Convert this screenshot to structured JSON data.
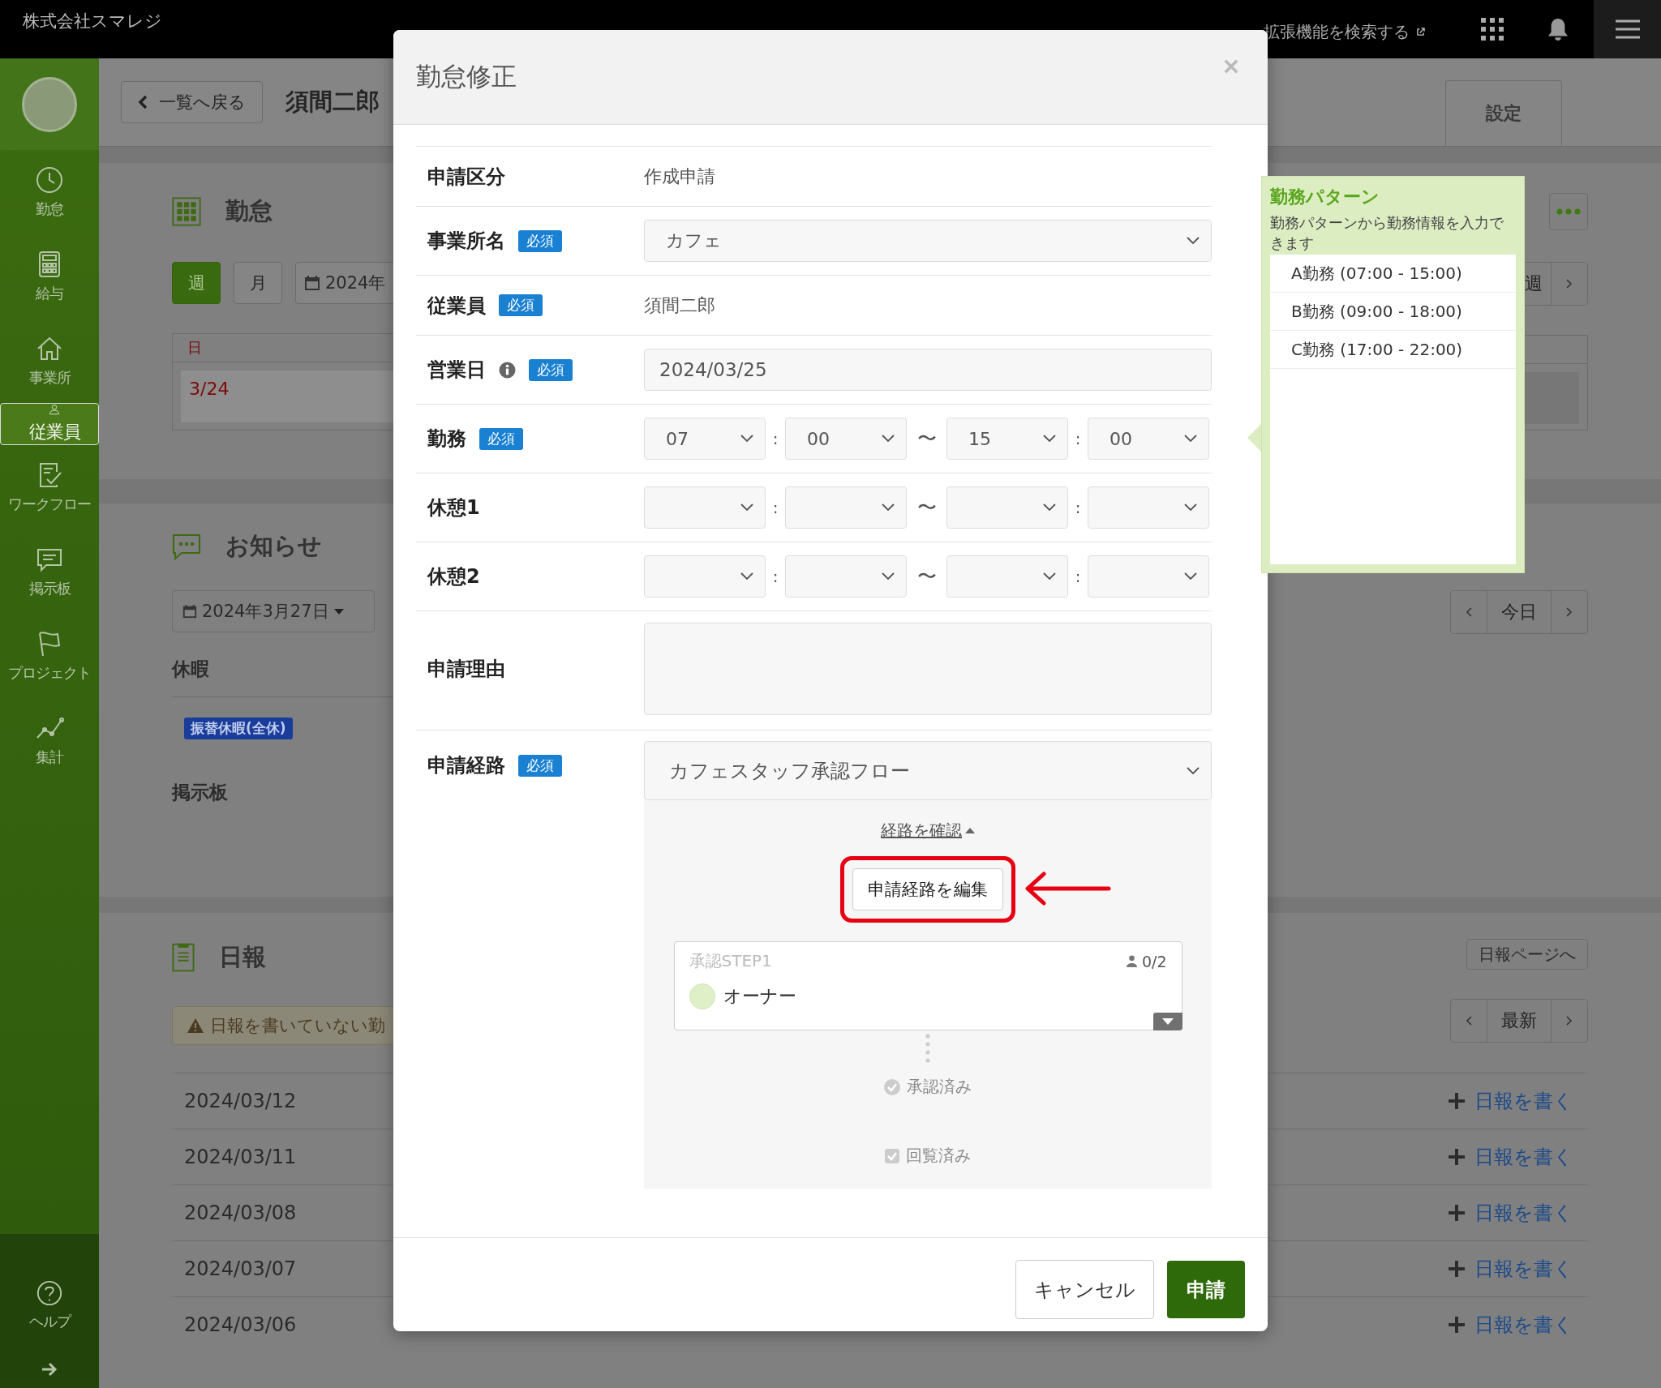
{
  "header": {
    "company": "株式会社スマレジ",
    "extension_search": "拡張機能を検索する"
  },
  "sidebar": {
    "items": [
      {
        "label": "勤怠",
        "selected": false
      },
      {
        "label": "給与",
        "selected": false
      },
      {
        "label": "事業所",
        "selected": false
      },
      {
        "label": "従業員",
        "selected": true
      },
      {
        "label": "ワークフロー",
        "selected": false
      },
      {
        "label": "掲示板",
        "selected": false
      },
      {
        "label": "プロジェクト",
        "selected": false
      },
      {
        "label": "集計",
        "selected": false
      }
    ],
    "help": "ヘルプ"
  },
  "page": {
    "back": "一覧へ戻る",
    "employee": "須間二郎",
    "settings": "設定"
  },
  "attendance": {
    "title": "勤怠",
    "views": [
      {
        "label": "週",
        "selected": true
      },
      {
        "label": "月",
        "selected": false
      }
    ],
    "date": "2024年",
    "day_header": "日",
    "day": "3/24",
    "week_label": "週"
  },
  "notices": {
    "title": "お知らせ",
    "date": "2024年3月27日",
    "vacation_heading": "休暇",
    "vacation_tag": "振替休暇(全休)",
    "board_heading": "掲示板",
    "today": "今日"
  },
  "daily_reports": {
    "title": "日報",
    "page_link": "日報ページへ",
    "warning": "日報を書いていない勤",
    "latest": "最新",
    "rows": [
      {
        "date": "2024/03/12",
        "action": "日報を書く"
      },
      {
        "date": "2024/03/11",
        "action": "日報を書く"
      },
      {
        "date": "2024/03/08",
        "action": "日報を書く"
      },
      {
        "date": "2024/03/07",
        "action": "日報を書く"
      },
      {
        "date": "2024/03/06",
        "action": "日報を書く"
      }
    ]
  },
  "modal": {
    "title": "勤怠修正",
    "colon": ":",
    "tilde": "〜",
    "rows": [
      {
        "label": "申請区分",
        "kind": "text",
        "value": "作成申請"
      },
      {
        "label": "事業所名",
        "required": "必須",
        "kind": "select",
        "value": "カフェ"
      },
      {
        "label": "従業員",
        "required": "必須",
        "kind": "text",
        "value": "須間二郎"
      },
      {
        "label": "営業日",
        "info": true,
        "required": "必須",
        "kind": "input",
        "value": "2024/03/25"
      },
      {
        "label": "勤務",
        "required": "必須",
        "kind": "time",
        "times": [
          "07",
          "00",
          "15",
          "00"
        ]
      },
      {
        "label": "休憩1",
        "kind": "time"
      },
      {
        "label": "休憩2",
        "kind": "time"
      },
      {
        "label": "申請理由",
        "kind": "textarea"
      }
    ],
    "route": {
      "label": "申請経路",
      "required": "必須",
      "value": "カフェスタッフ承認フロー",
      "toggle": "経路を確認",
      "edit_button": "申請経路を編集",
      "edit_highlighted": true,
      "step": {
        "name": "承認STEP1",
        "count": "0/2",
        "approver": "オーナー"
      },
      "approved": "承認済み",
      "circulated": "回覧済み"
    },
    "cancel": "キャンセル",
    "submit": "申請"
  },
  "pattern_popover": {
    "title": "勤務パターン",
    "description": "勤務パターンから勤務情報を入力できます",
    "patterns": [
      "A勤務 (07:00 - 15:00)",
      "B勤務 (09:00 - 18:00)",
      "C勤務 (17:00 - 22:00)"
    ]
  }
}
